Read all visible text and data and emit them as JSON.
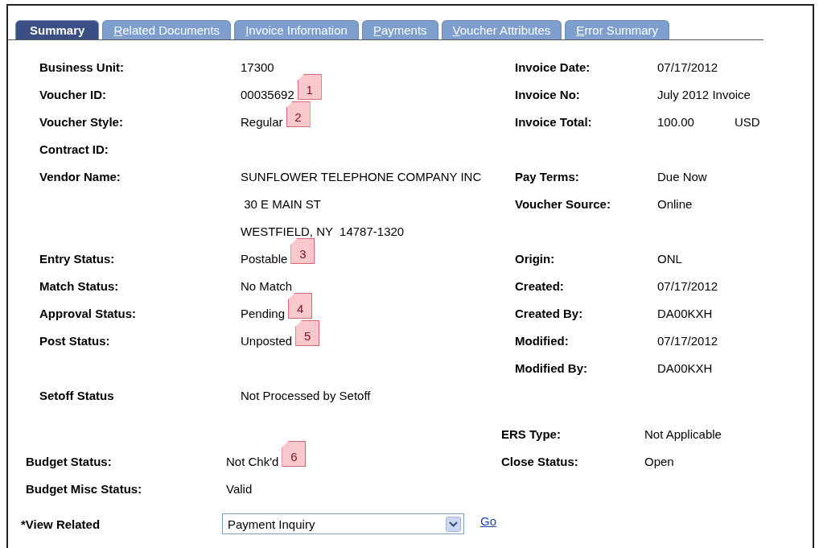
{
  "tabs": [
    {
      "label": "Summary",
      "selected": true,
      "underline_first": false
    },
    {
      "label": "Related Documents",
      "selected": false,
      "underline_first": true
    },
    {
      "label": "Invoice Information",
      "selected": false,
      "underline_first": true
    },
    {
      "label": "Payments",
      "selected": false,
      "underline_first": true
    },
    {
      "label": "Voucher Attributes",
      "selected": false,
      "underline_first": true
    },
    {
      "label": "Error Summary",
      "selected": false,
      "underline_first": true
    }
  ],
  "rows": [
    {
      "left": {
        "label": "Business Unit:",
        "value": "17300"
      },
      "right": {
        "label": "Invoice Date:",
        "value": "07/17/2012"
      }
    },
    {
      "left": {
        "label": "Voucher ID:",
        "value": "00035692",
        "note": "1"
      },
      "right": {
        "label": "Invoice No:",
        "value": "July 2012 Invoice"
      }
    },
    {
      "left": {
        "label": "Voucher Style:",
        "value": "Regular",
        "note": "2"
      },
      "right": {
        "label": "Invoice Total:",
        "value": "100.00",
        "currency": "USD"
      }
    },
    {
      "left": {
        "label": "Contract ID:"
      }
    },
    {
      "left": {
        "label": "Vendor Name:",
        "value": "SUNFLOWER TELEPHONE COMPANY INC"
      },
      "right": {
        "label": "Pay Terms:",
        "value": "Due Now"
      }
    },
    {
      "left": {
        "value": " 30 E MAIN ST"
      },
      "right": {
        "label": "Voucher Source:",
        "value": "Online"
      }
    },
    {
      "left": {
        "value": "WESTFIELD, NY  14787-1320"
      }
    },
    {
      "left": {
        "label": "Entry Status:",
        "value": "Postable",
        "note": "3"
      },
      "right": {
        "label": "Origin:",
        "value": "ONL"
      }
    },
    {
      "left": {
        "label": "Match Status:",
        "value": "No Match"
      },
      "right": {
        "label": "Created:",
        "value": "07/17/2012"
      }
    },
    {
      "left": {
        "label": "Approval Status:",
        "value": "Pending",
        "note": "4"
      },
      "right": {
        "label": "Created By:",
        "value": "DA00KXH"
      }
    },
    {
      "left": {
        "label": "Post Status:",
        "value": "Unposted",
        "note": "5"
      },
      "right": {
        "label": "Modified:",
        "value": "07/17/2012"
      }
    },
    {
      "right": {
        "label": "Modified By:",
        "value": "DA00KXH"
      }
    },
    {
      "left": {
        "label": "Setoff Status",
        "value": "Not Processed by Setoff"
      }
    }
  ],
  "lower_rows": [
    {
      "right": {
        "label": "ERS Type:",
        "value": "Not Applicable"
      }
    },
    {
      "left": {
        "label": "Budget Status:",
        "value": "Not Chk'd",
        "note": "6"
      },
      "right": {
        "label": "Close Status:",
        "value": "Open"
      }
    },
    {
      "left": {
        "label": "Budget Misc Status:",
        "value": "Valid"
      }
    }
  ],
  "view_related": {
    "label": "*View Related",
    "value": "Payment Inquiry",
    "link": "Go"
  }
}
